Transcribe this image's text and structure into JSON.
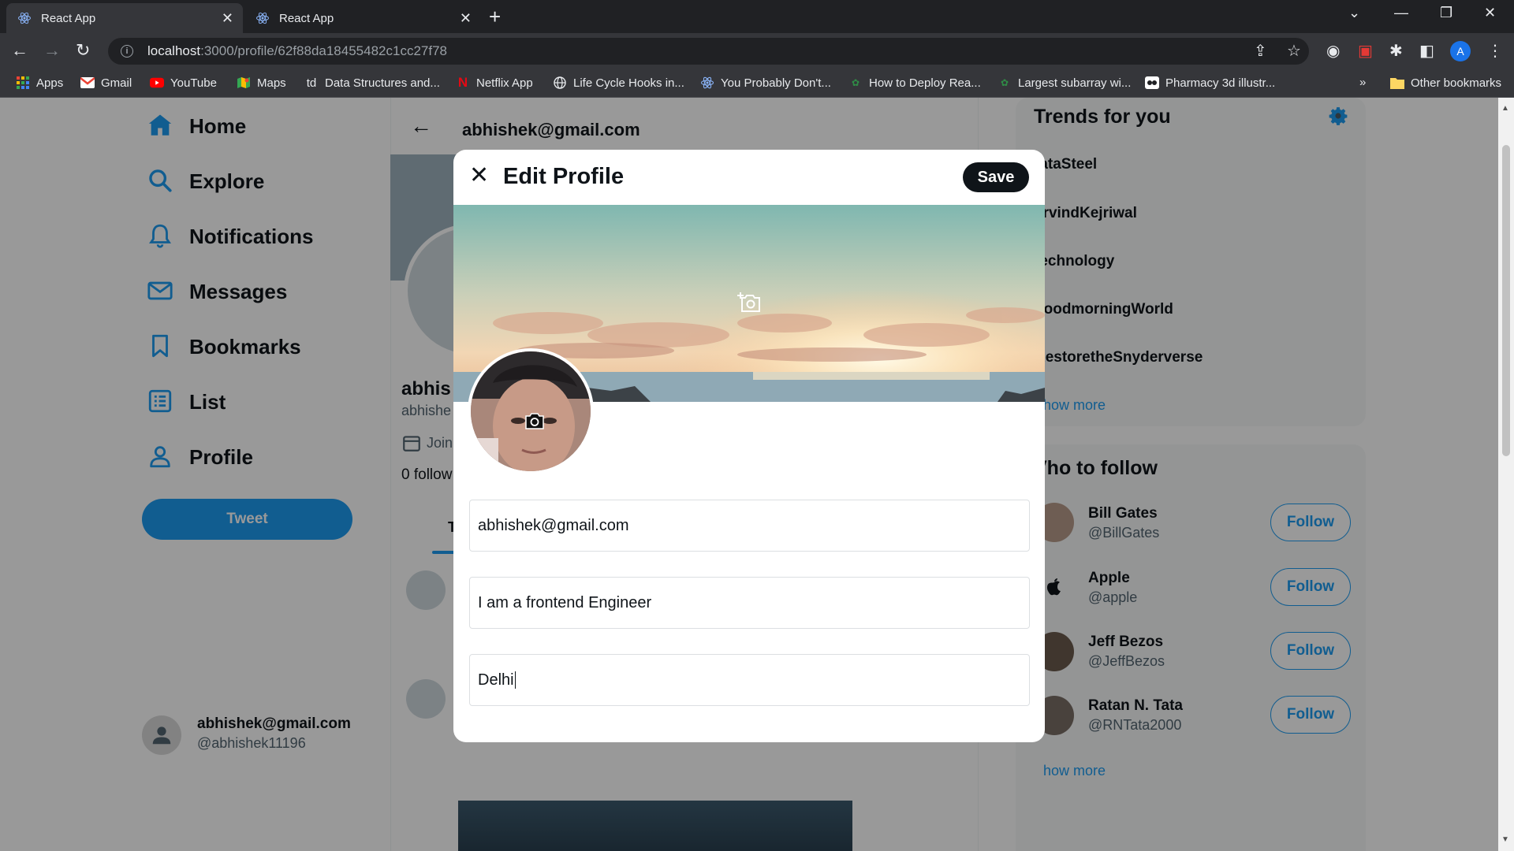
{
  "browser": {
    "tabs": [
      {
        "title": "React App",
        "active": true
      },
      {
        "title": "React App",
        "active": false
      }
    ],
    "url_host": "localhost",
    "url_path": ":3000/profile/62f88da18455482c1cc27f78",
    "profile_initial": "A",
    "bookmarks": [
      {
        "label": "Apps",
        "icon": "apps-grid-icon"
      },
      {
        "label": "Gmail",
        "icon": "gmail-icon"
      },
      {
        "label": "YouTube",
        "icon": "youtube-icon"
      },
      {
        "label": "Maps",
        "icon": "maps-icon"
      },
      {
        "label": "Data Structures and...",
        "icon": "td-icon",
        "icon_text": "td"
      },
      {
        "label": "Netflix App",
        "icon": "netflix-icon",
        "icon_text": "N"
      },
      {
        "label": "Life Cycle Hooks in...",
        "icon": "globe-icon"
      },
      {
        "label": "You Probably Don't...",
        "icon": "react-icon"
      },
      {
        "label": "How to Deploy Rea...",
        "icon": "leaf-icon"
      },
      {
        "label": "Largest subarray wi...",
        "icon": "leaf-icon"
      },
      {
        "label": "Pharmacy 3d illustr...",
        "icon": "pharmacy-icon"
      }
    ],
    "more_bookmarks": "»",
    "other_bookmarks": "Other bookmarks"
  },
  "sidebar": {
    "items": [
      {
        "label": "Home",
        "icon": "home-icon"
      },
      {
        "label": "Explore",
        "icon": "search-icon"
      },
      {
        "label": "Notifications",
        "icon": "bell-icon"
      },
      {
        "label": "Messages",
        "icon": "mail-icon"
      },
      {
        "label": "Bookmarks",
        "icon": "bookmark-icon"
      },
      {
        "label": "List",
        "icon": "list-icon"
      },
      {
        "label": "Profile",
        "icon": "person-icon"
      }
    ],
    "tweet_label": "Tweet",
    "account": {
      "name": "abhishek@gmail.com",
      "handle": "@abhishek11196"
    }
  },
  "profile": {
    "header": "abhishek@gmail.com",
    "name_partial": "abhis",
    "handle_partial": "abhishe",
    "joined_partial": "Join",
    "followers_partial": "0 follow",
    "tab_partial": "T"
  },
  "trends": {
    "title": "Trends for you",
    "items": [
      "tataSteel",
      "arvindKejriwal",
      "technology",
      "goodmorningWorld",
      "RestoretheSnyderverse"
    ],
    "show_more": "how more"
  },
  "who_to_follow": {
    "title": "Vho to follow",
    "accounts": [
      {
        "name": "Bill Gates",
        "handle": "@BillGates",
        "button": "Follow"
      },
      {
        "name": "Apple",
        "handle": "@apple",
        "button": "Follow"
      },
      {
        "name": "Jeff Bezos",
        "handle": "@JeffBezos",
        "button": "Follow"
      },
      {
        "name": "Ratan N. Tata",
        "handle": "@RNTata2000",
        "button": "Follow"
      }
    ],
    "show_more": "how more"
  },
  "modal": {
    "title": "Edit Profile",
    "save_label": "Save",
    "fields": {
      "name": "abhishek@gmail.com",
      "bio": "I am a frontend Engineer",
      "location": "Delhi"
    }
  },
  "colors": {
    "accent": "#1d9bf0",
    "text": "#0f1419",
    "muted": "#536471"
  }
}
